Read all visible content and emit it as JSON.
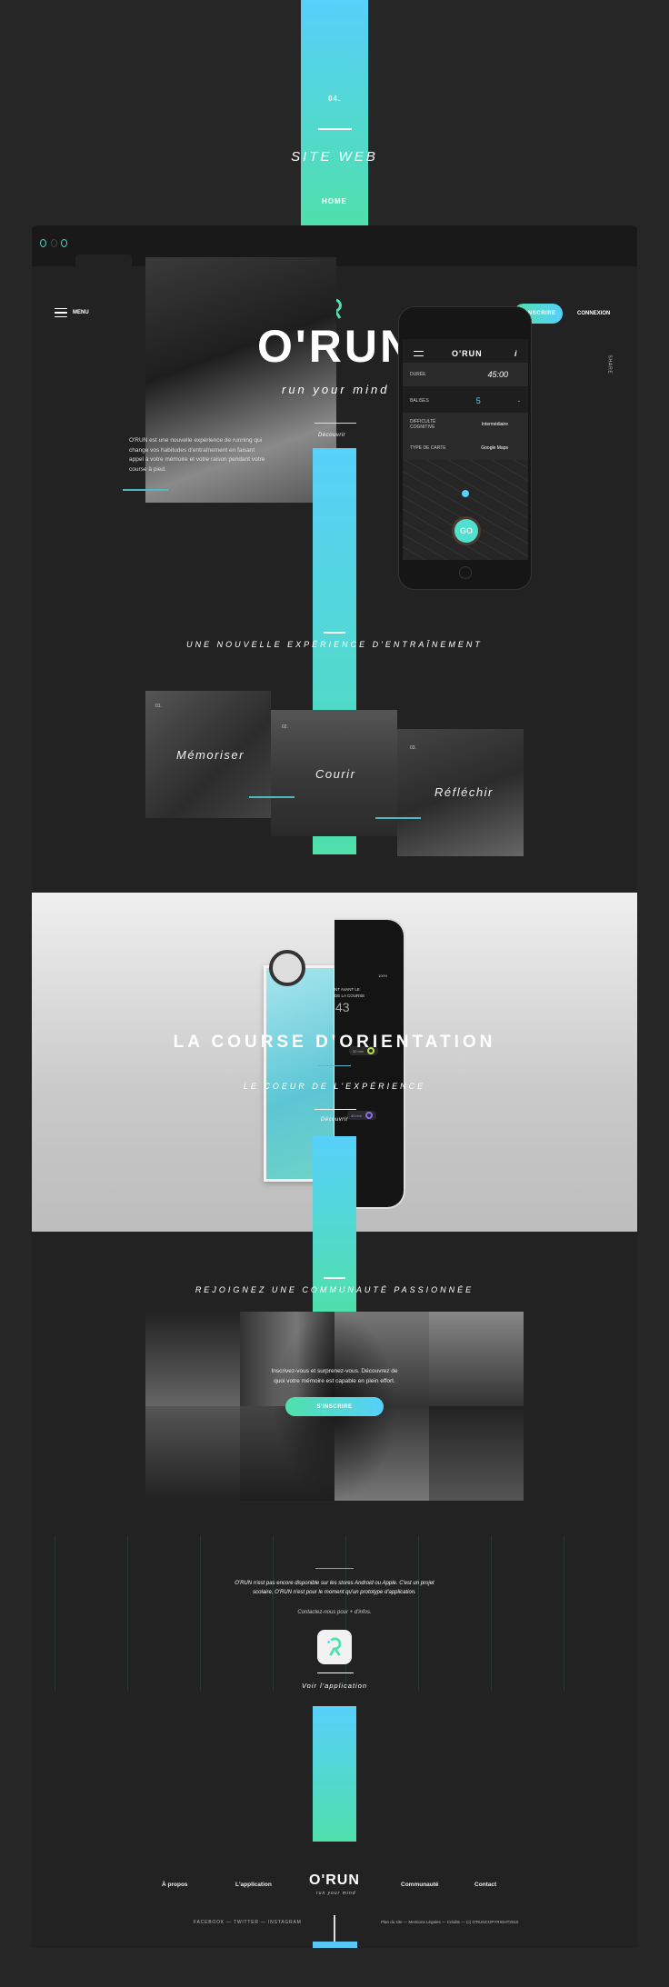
{
  "header": {
    "number": "04.",
    "title": "SITE WEB",
    "subtitle": "HOME"
  },
  "colors": {
    "accent_blue": "#57d0fb",
    "accent_green": "#4fe0ab",
    "background": "#262626"
  },
  "nav": {
    "menu_label": "MENU",
    "signup": "S'INSCRIRE",
    "login": "CONNEXION",
    "share": "SHARE"
  },
  "hero": {
    "logo": "O'RUN",
    "tagline": "run your mind",
    "discover": "Découvrir",
    "description": "O'RUN est une nouvelle expérience de running qui change vos habitudes d'entraînement en faisant appel à votre mémoire et votre raison pendant votre course à pied."
  },
  "phone": {
    "logo": "O'RUN",
    "info": "i",
    "rows": [
      {
        "label": "DURÉE",
        "value": "45:00"
      },
      {
        "label": "BALISES",
        "value": "5"
      },
      {
        "label": "DIFFICULTÉ COGNITIVE",
        "value": "Intermédiaire"
      },
      {
        "label": "TYPE DE CARTE",
        "value": "Google Maps"
      }
    ],
    "go": "GO"
  },
  "features": {
    "title": "UNE NOUVELLE EXPÉRIENCE D'ENTRAÎNEMENT",
    "cards": [
      {
        "num": "01.",
        "title": "Mémoriser"
      },
      {
        "num": "02.",
        "title": "Courir"
      },
      {
        "num": "03.",
        "title": "Réfléchir"
      }
    ]
  },
  "orientation": {
    "title": "LA COURSE D'ORIENTATION",
    "subtitle": "LE COEUR DE L'EXPÉRIENCE",
    "discover": "Découvrir",
    "phone_text": "NT AVANT LE\nDE LA COURSE",
    "phone_time": "43",
    "phone_status": "100%",
    "marker1": "30 min",
    "marker2": "40 min"
  },
  "community": {
    "title": "REJOIGNEZ UNE COMMUNAUTÉ PASSIONNÉE",
    "text": "Inscrivez-vous et surprenez-vous. Découvrez de quoi votre mémoire est capable en plein effort.",
    "button": "S'INSCRIRE"
  },
  "app": {
    "text1": "O'RUN n'est pas encore disponible sur les stores Android ou Apple. C'est un projet scolaire, O'RUN n'est pour le moment qu'un prototype d'application.",
    "text2": "Contactez-nous pour + d'infos.",
    "link": "Voir l'application"
  },
  "footer": {
    "links": [
      "À propos",
      "L'application",
      "Communauté",
      "Contact"
    ],
    "logo": "O'RUN",
    "tagline": "run your mind",
    "social": "FACEBOOK — TWITTER — INSTAGRAM",
    "legal": "Plan du site — Mentions Légales — Crédits — (c) O'RUNCOPYRIGHT2015"
  }
}
